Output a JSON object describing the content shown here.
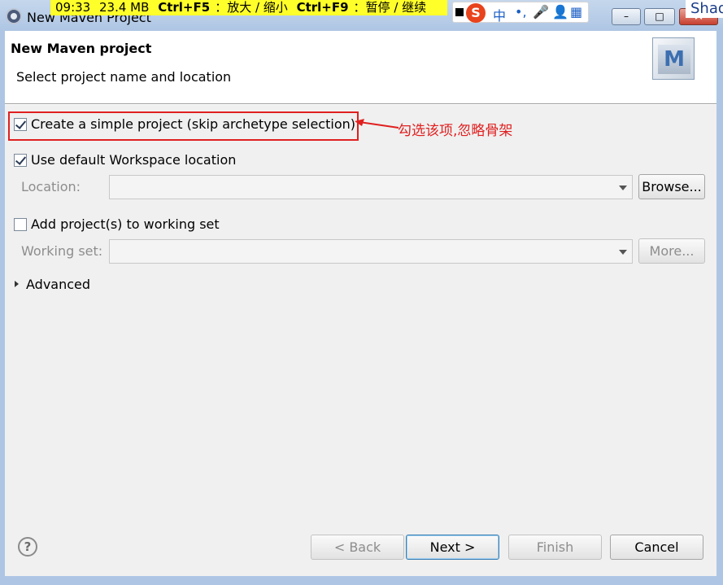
{
  "window": {
    "title": "New Maven Project",
    "controls": {
      "minimize": "–",
      "maximize": "□",
      "close": "✕"
    }
  },
  "recorder_overlay": {
    "time": "09:33",
    "size": "23.4 MB",
    "hotkey1": "Ctrl+F5",
    "hotkey1_desc": "：放大 / 缩小",
    "hotkey2": "Ctrl+F9",
    "hotkey2_desc": "：暂停 / 继续"
  },
  "ime_bar": {
    "logo": "S",
    "mode": "中",
    "punct": "•,",
    "mic": "🎤",
    "user": "👤",
    "grid": "▦"
  },
  "background_window_text": "Shad",
  "header": {
    "title": "New Maven project",
    "description": "Select project name and location",
    "banner_letter": "M"
  },
  "options": {
    "simple_project": {
      "label": "Create a simple project (skip archetype selection)",
      "checked": true
    },
    "default_workspace": {
      "label": "Use default Workspace location",
      "checked": true
    },
    "location_label": "Location:",
    "location_value": "",
    "browse_label": "Browse...",
    "working_set_checkbox": {
      "label": "Add project(s) to working set",
      "checked": false
    },
    "working_set_label": "Working set:",
    "working_set_value": "",
    "more_label": "More...",
    "advanced_label": "Advanced"
  },
  "annotation": {
    "text": "勾选该项,忽略骨架",
    "color": "#e02020"
  },
  "footer": {
    "help": "?",
    "back_label": "< Back",
    "next_label": "Next >",
    "finish_label": "Finish",
    "cancel_label": "Cancel"
  }
}
